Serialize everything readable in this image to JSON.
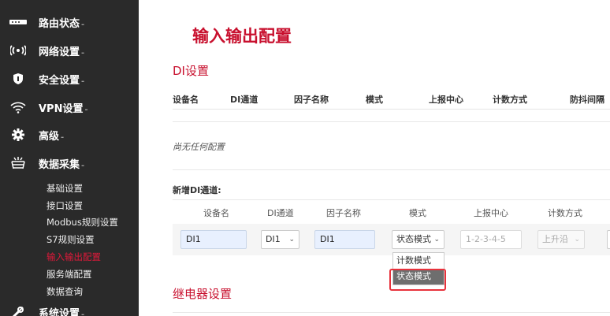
{
  "sidebar": {
    "items": [
      {
        "label": "路由状态",
        "icon": "router-status-icon"
      },
      {
        "label": "网络设置",
        "icon": "wireless-icon"
      },
      {
        "label": "安全设置",
        "icon": "shield-icon"
      },
      {
        "label": "VPN设置",
        "icon": "wifi-icon"
      },
      {
        "label": "高级",
        "icon": "gear-icon"
      },
      {
        "label": "数据采集",
        "icon": "data-collect-icon"
      },
      {
        "label": "系统设置",
        "icon": "wrench-icon"
      }
    ],
    "caret": "-",
    "sub_items": [
      {
        "label": "基础设置"
      },
      {
        "label": "接口设置"
      },
      {
        "label": "Modbus规则设置"
      },
      {
        "label": "S7规则设置"
      },
      {
        "label": "输入输出配置"
      },
      {
        "label": "服务端配置"
      },
      {
        "label": "数据查询"
      }
    ],
    "active_sub": "输入输出配置"
  },
  "main": {
    "title": "输入输出配置",
    "di_section_title": "DI设置",
    "table_headers": [
      "设备名",
      "DI通道",
      "因子名称",
      "模式",
      "上报中心",
      "计数方式",
      "防抖间隔"
    ],
    "empty_text": "尚无任何配置",
    "add_label": "新增DI通道:",
    "form_headers": [
      "设备名",
      "DI通道",
      "因子名称",
      "模式",
      "上报中心",
      "计数方式"
    ],
    "form": {
      "device_name": "DI1",
      "di_channel": "DI1",
      "factor_name": "DI1",
      "mode": "状态模式",
      "report_center_placeholder": "1-2-3-4-5",
      "count_method": "上升沿"
    },
    "mode_options": [
      "计数模式",
      "状态模式"
    ],
    "relay_section_title": "继电器设置"
  },
  "colors": {
    "accent": "#c8102e",
    "sidebar_bg": "#2a2a2a",
    "highlight": "#e8323c"
  }
}
